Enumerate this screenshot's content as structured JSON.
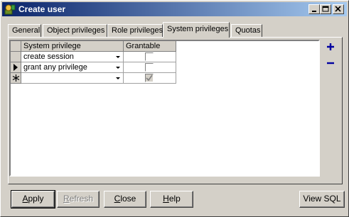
{
  "window": {
    "title": "Create user",
    "minimize_label": "minimize",
    "maximize_label": "maximize",
    "close_label": "close"
  },
  "tabs": [
    {
      "label": "General",
      "active": false
    },
    {
      "label": "Object privileges",
      "active": false
    },
    {
      "label": "Role privileges",
      "active": false
    },
    {
      "label": "System privileges",
      "active": true
    },
    {
      "label": "Quotas",
      "active": false
    }
  ],
  "grid": {
    "columns": [
      "System privilege",
      "Grantable"
    ],
    "rows": [
      {
        "privilege": "create session",
        "grantable": false,
        "indicator": ""
      },
      {
        "privilege": "grant any privilege",
        "grantable": false,
        "indicator": "current"
      },
      {
        "privilege": "",
        "grantable": true,
        "indicator": "new"
      }
    ]
  },
  "side_buttons": {
    "add_icon": "plus-icon",
    "remove_icon": "minus-icon"
  },
  "buttons": {
    "apply": {
      "prefix": "",
      "accel": "A",
      "rest": "pply"
    },
    "refresh": {
      "prefix": "",
      "accel": "R",
      "rest": "efresh"
    },
    "close": {
      "prefix": "",
      "accel": "C",
      "rest": "lose"
    },
    "help": {
      "prefix": "",
      "accel": "H",
      "rest": "elp"
    },
    "view_sql": {
      "label": "View SQL"
    }
  },
  "colors": {
    "title_start": "#0a246a",
    "title_end": "#a6caf0",
    "accent_blue": "#0000a0"
  }
}
